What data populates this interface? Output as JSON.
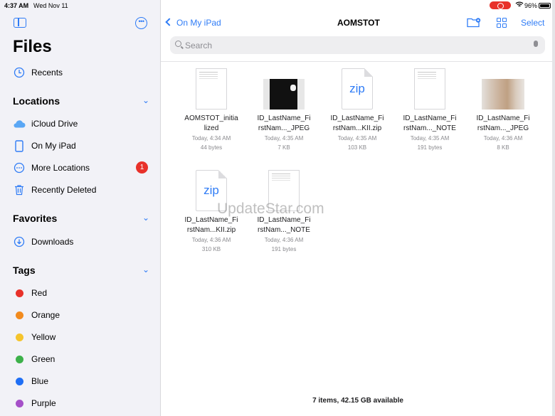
{
  "status_bar": {
    "time": "4:37 AM",
    "date": "Wed Nov 11",
    "battery": "96%"
  },
  "sidebar": {
    "title": "Files",
    "recents": "Recents",
    "locations_title": "Locations",
    "locations": [
      {
        "label": "iCloud Drive",
        "icon": "cloud-icon"
      },
      {
        "label": "On My iPad",
        "icon": "ipad-icon"
      },
      {
        "label": "More Locations",
        "icon": "ellipsis-circle-icon",
        "badge": "1"
      },
      {
        "label": "Recently Deleted",
        "icon": "trash-icon"
      }
    ],
    "favorites_title": "Favorites",
    "favorites": [
      {
        "label": "Downloads",
        "icon": "download-icon"
      }
    ],
    "tags_title": "Tags",
    "tags": [
      {
        "label": "Red",
        "color": "#e8312a"
      },
      {
        "label": "Orange",
        "color": "#f28b1e"
      },
      {
        "label": "Yellow",
        "color": "#f5c42c"
      },
      {
        "label": "Green",
        "color": "#3db14a"
      },
      {
        "label": "Blue",
        "color": "#1f6ff5"
      },
      {
        "label": "Purple",
        "color": "#a550c8"
      }
    ]
  },
  "main": {
    "back_label": "On My iPad",
    "folder_title": "AOMSTOT",
    "select_label": "Select",
    "search_placeholder": "Search",
    "files": [
      {
        "name_line1": "AOMSTOT_initia",
        "name_line2": "lized",
        "date": "Today, 4:34 AM",
        "size": "44 bytes",
        "kind": "doc"
      },
      {
        "name_line1": "ID_LastName_Fi",
        "name_line2": "rstNam..._JPEG",
        "date": "Today, 4:35 AM",
        "size": "7 KB",
        "kind": "photo-dark"
      },
      {
        "name_line1": "ID_LastName_Fi",
        "name_line2": "rstNam...KII.zip",
        "date": "Today, 4:35 AM",
        "size": "103 KB",
        "kind": "zip"
      },
      {
        "name_line1": "ID_LastName_Fi",
        "name_line2": "rstNam..._NOTE",
        "date": "Today, 4:35 AM",
        "size": "191 bytes",
        "kind": "doc"
      },
      {
        "name_line1": "ID_LastName_Fi",
        "name_line2": "rstNam..._JPEG",
        "date": "Today, 4:36 AM",
        "size": "8 KB",
        "kind": "photo-skin"
      },
      {
        "name_line1": "ID_LastName_Fi",
        "name_line2": "rstNam...KII.zip",
        "date": "Today, 4:36 AM",
        "size": "310 KB",
        "kind": "zip"
      },
      {
        "name_line1": "ID_LastName_Fi",
        "name_line2": "rstNam..._NOTE",
        "date": "Today, 4:36 AM",
        "size": "191 bytes",
        "kind": "doc"
      }
    ],
    "zip_label": "zip",
    "footer": "7 items, 42.15 GB available",
    "watermark": "UpdateStar.com"
  }
}
